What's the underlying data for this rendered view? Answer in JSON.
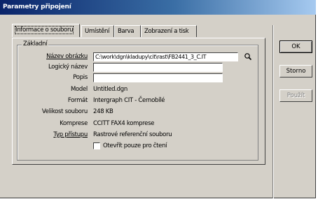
{
  "window": {
    "title": "Parametry připojení"
  },
  "tabs": [
    {
      "label": "Informace o souboru"
    },
    {
      "label": "Umístění"
    },
    {
      "label": "Barva"
    },
    {
      "label": "Zobrazení a tisk"
    }
  ],
  "group": {
    "title": "Základní"
  },
  "fields": {
    "name_label": "Název obrázku",
    "name_value": "C:\\work\\dgn\\kladupy\\cit\\rast\\FB2441_3_C.IT",
    "logical_label": "Logický název",
    "logical_value": "",
    "desc_label": "Popis",
    "desc_value": "",
    "model_label": "Model",
    "model_value": "Untitled.dgn",
    "format_label": "Formát",
    "format_value": "Intergraph CIT - Černobílé",
    "size_label": "Velikost souboru",
    "size_value": "248 KB",
    "compression_label": "Komprese",
    "compression_value": "CCITT FAX4 komprese",
    "access_label": "Typ přístupu",
    "access_value": "Rastrové referenční souboru",
    "readonly_label": "Otevřít pouze pro čtení",
    "readonly_checked": false
  },
  "buttons": {
    "ok": "OK",
    "cancel": "Storno",
    "apply": "Použít"
  },
  "icons": {
    "browse": "magnifier-icon"
  },
  "colors": {
    "title_start": "#0a246a",
    "title_end": "#a6caf0",
    "face": "#d4d0c8"
  }
}
